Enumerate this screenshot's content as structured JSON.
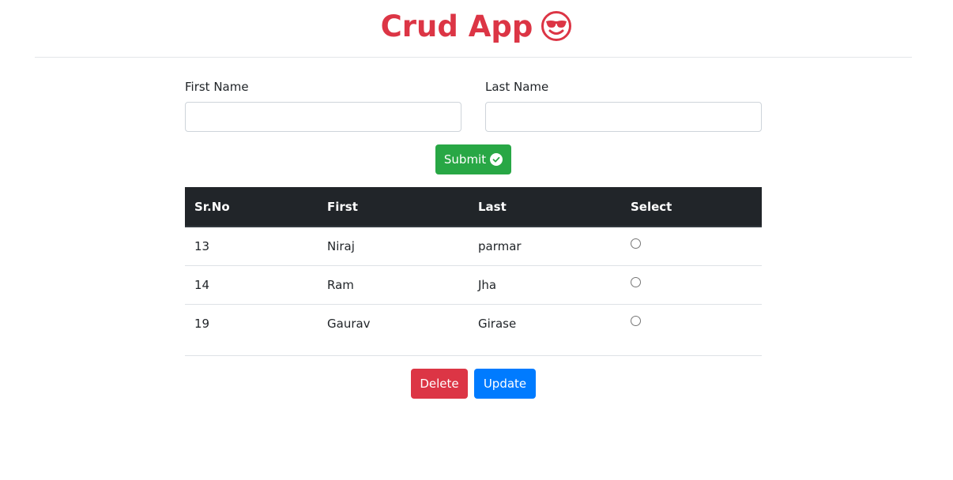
{
  "app": {
    "title": "Crud App",
    "accent": "#dc3545"
  },
  "form": {
    "first_name": {
      "label": "First Name",
      "value": "",
      "placeholder": ""
    },
    "last_name": {
      "label": "Last Name",
      "value": "",
      "placeholder": ""
    },
    "submit_label": "Submit"
  },
  "table": {
    "headers": [
      "Sr.No",
      "First",
      "Last",
      "Select"
    ],
    "rows": [
      {
        "sr": "13",
        "first": "Niraj",
        "last": "parmar",
        "selected": false
      },
      {
        "sr": "14",
        "first": "Ram",
        "last": "Jha",
        "selected": false
      },
      {
        "sr": "19",
        "first": "Gaurav",
        "last": "Girase",
        "selected": false
      }
    ]
  },
  "actions": {
    "delete_label": "Delete",
    "update_label": "Update"
  },
  "colors": {
    "submit": "#28a745",
    "delete": "#dc3545",
    "update": "#007bff",
    "table_header": "#212529"
  },
  "icons": {
    "title_icon": "smiling-face-with-sunglasses-icon",
    "submit_icon": "check-circle-icon"
  }
}
